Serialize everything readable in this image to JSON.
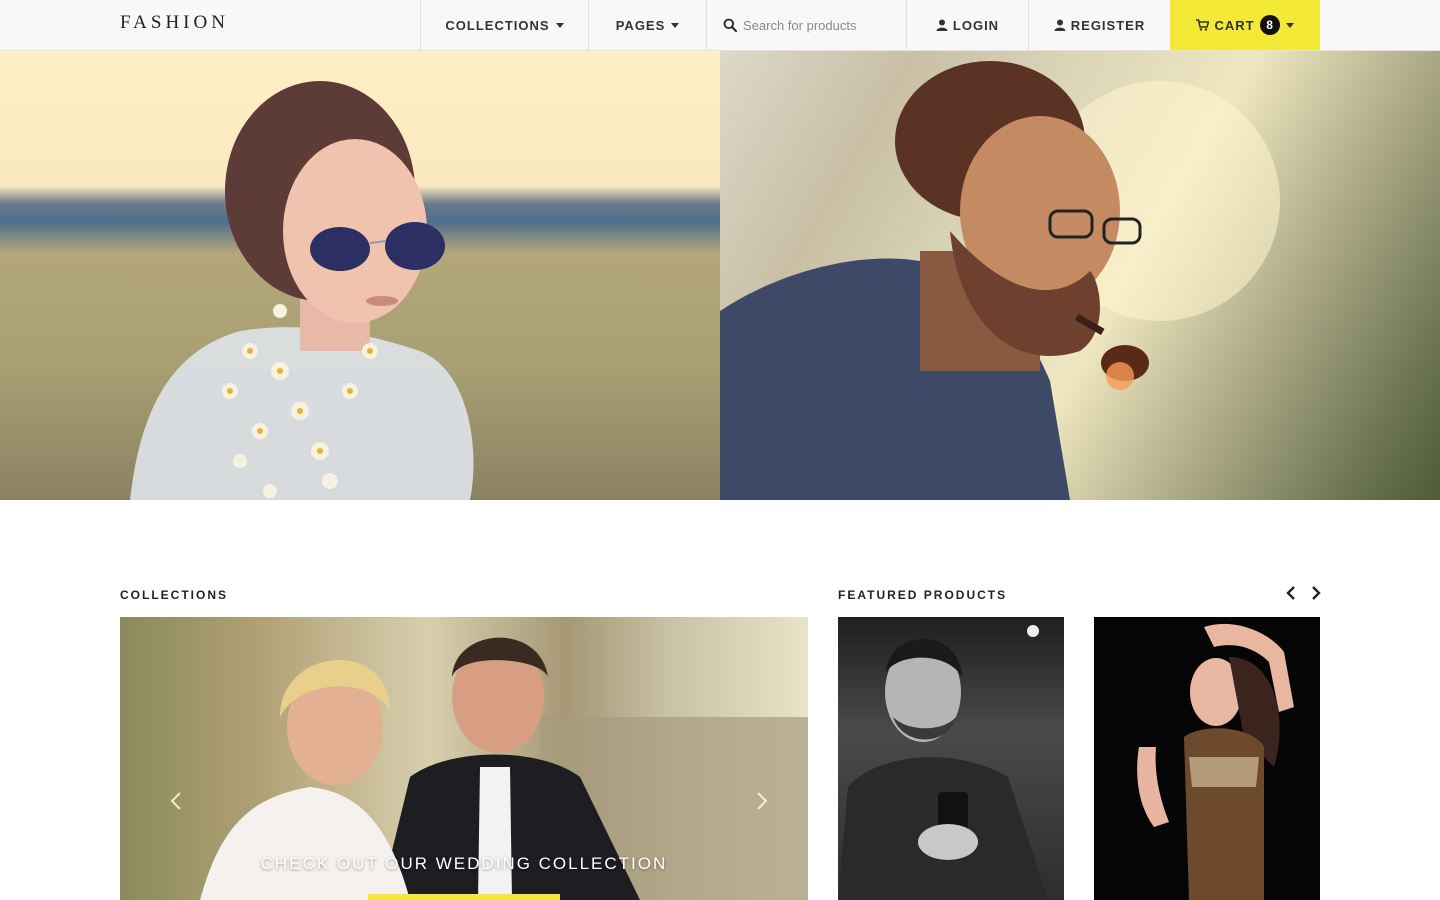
{
  "brand": {
    "name": "FASHION"
  },
  "nav": {
    "collections": "COLLECTIONS",
    "pages": "PAGES",
    "search_placeholder": "Search for products",
    "login": "LOGIN",
    "register": "REGISTER",
    "cart": "CART",
    "cart_count": "8"
  },
  "icons": {
    "search": "search-icon",
    "user": "user-icon",
    "cart": "cart-icon",
    "caret": "caret-down-icon",
    "prev": "chevron-left-icon",
    "next": "chevron-right-icon"
  },
  "colors": {
    "accent": "#f5e937",
    "navbar_bg": "#f8f8f8",
    "text": "#222222"
  },
  "sections": {
    "collections_title": "COLLECTIONS",
    "featured_title": "FEATURED PRODUCTS"
  },
  "carousel": {
    "caption": "CHECK OUT OUR WEDDING COLLECTION"
  }
}
